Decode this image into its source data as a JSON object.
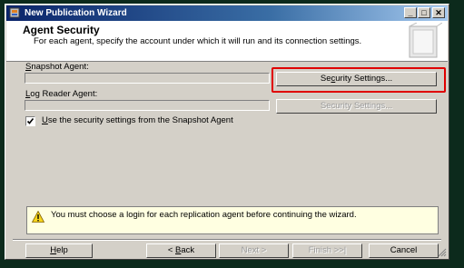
{
  "window": {
    "title": "New Publication Wizard",
    "minimize": "_",
    "maximize": "□",
    "close": "✕"
  },
  "header": {
    "title": "Agent Security",
    "subtitle": "For each agent, specify the account under which it will run and its connection settings."
  },
  "snapshot_agent": {
    "label_accel": "S",
    "label_rest": "napshot Agent:",
    "button_prefix": "Se",
    "button_accel": "c",
    "button_rest": "urity Settings..."
  },
  "log_reader_agent": {
    "label_accel": "L",
    "label_rest": "og Reader Agent:",
    "button_label": "Security Settings...",
    "enabled": false
  },
  "use_snapshot_settings": {
    "checked": true,
    "accel": "U",
    "label_rest": "se the security settings from the Snapshot Agent"
  },
  "warning": {
    "icon": "warning-icon",
    "text": "You must choose a login for each replication agent before continuing the wizard."
  },
  "footer": {
    "help_accel": "H",
    "help_rest": "elp",
    "back_prefix": "< ",
    "back_accel": "B",
    "back_rest": "ack",
    "next_label": "Next >",
    "finish_label": "Finish >>|",
    "cancel_label": "Cancel"
  },
  "colors": {
    "dialog_face": "#d4d0c8",
    "title_gradient_start": "#0a246a",
    "highlight_border": "#e00000",
    "warning_background": "#ffffe1"
  }
}
